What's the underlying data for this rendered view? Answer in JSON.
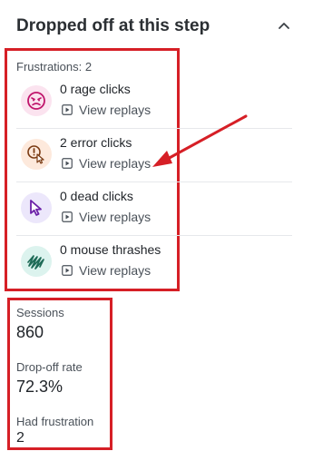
{
  "header": {
    "title": "Dropped off at this step"
  },
  "frustrations": {
    "label": "Frustrations: 2",
    "items": [
      {
        "label": "0 rage clicks",
        "replay": "View replays",
        "icon": "angry-face-icon",
        "bg": "#fbe3ef",
        "color": "#c0156c"
      },
      {
        "label": "2 error clicks",
        "replay": "View replays",
        "icon": "error-cursor-icon",
        "bg": "#fde9dc",
        "color": "#7a3a12"
      },
      {
        "label": "0 dead clicks",
        "replay": "View replays",
        "icon": "cursor-icon",
        "bg": "#ece7fb",
        "color": "#6b21a8"
      },
      {
        "label": "0 mouse thrashes",
        "replay": "View replays",
        "icon": "scribble-icon",
        "bg": "#dcf3ee",
        "color": "#1e6b57"
      }
    ]
  },
  "stats": {
    "sessions_label": "Sessions",
    "sessions_value": "860",
    "dropoff_label": "Drop-off rate",
    "dropoff_value": "72.3%",
    "frustration_label": "Had frustration",
    "frustration_value": "2"
  },
  "colors": {
    "highlight": "#d61f26"
  }
}
